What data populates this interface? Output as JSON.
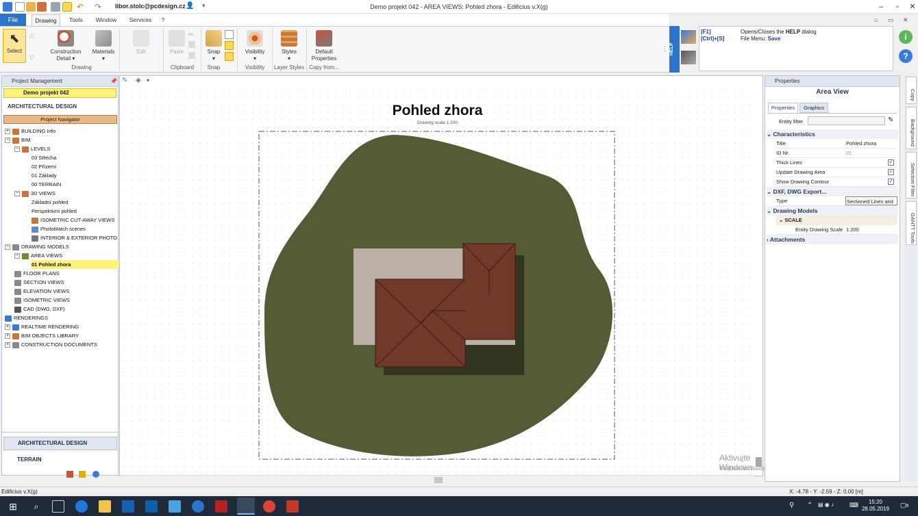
{
  "window": {
    "user": "libor.stolc@pcdesign.cz",
    "title": "Demo projekt 042  -  AREA VIEWS: Pohled zhora - Edificius v.X(g)"
  },
  "menu": {
    "file": "File",
    "tabs": [
      "Drawing",
      "Tools",
      "Window",
      "Services",
      "?"
    ]
  },
  "ribbon": {
    "select": "Select",
    "construction_detail": "Construction Detail",
    "materials": "Materials",
    "edit": "Edit",
    "paste": "Paste",
    "snap": "Snap",
    "visibility": "Visibility",
    "styles": "Styles",
    "default_properties": "Default Properties",
    "groups": [
      "Drawing",
      "Clipboard",
      "Snap",
      "Visibility",
      "Layer Styles",
      "Copy from..."
    ],
    "help_strip": "HELP"
  },
  "help": {
    "key1": "[F1]",
    "key2": "[Ctrl]+[S]",
    "desc1_pre": "Opens/Closes the ",
    "desc1_bold": "HELP",
    "desc1_post": " dialog",
    "desc2_pre": "File Menu: ",
    "desc2_bold": "Save"
  },
  "left_panel": {
    "header": "Project Management",
    "project": "Demo projekt 042",
    "section": "ARCHITECTURAL DESIGN",
    "navigator": "Project Navigator",
    "tree": [
      "BUILDING Info",
      "BIM",
      "LEVELS",
      "03 Střecha",
      "02 Přízemí",
      "01 Základy",
      "00 TERRAIN",
      "3D VIEWS",
      "Základní pohled",
      "Perspektivní pohled",
      "ISOMETRIC CUT-AWAY VIEWS",
      "PhotoMatch scenes",
      "INTERIOR & EXTERIOR PHOTO",
      "DRAWING MODELS",
      "AREA VIEWS",
      "01 Pohled zhora",
      "FLOOR PLANS",
      "SECTION VIEWS",
      "ELEVATION VIEWS",
      "ISOMETRIC VIEWS",
      "CAD (DWG, DXF)",
      "RENDERINGS",
      "REALTIME RENDERING",
      "BIM OBJECTS LIBRARY",
      "CONSTRUCTION DOCUMENTS"
    ],
    "bottom_arch": "ARCHITECTURAL DESIGN",
    "bottom_terrain": "TERRAIN"
  },
  "drawing": {
    "title": "Pohled zhora",
    "scale": "Drawing scale 1:200"
  },
  "properties": {
    "header": "Properties",
    "title": "Area View",
    "tab_properties": "Properties",
    "tab_graphics": "Graphics",
    "entity_filter": "Entity filter",
    "cat_characteristics": "Characteristics",
    "title_label": "Title",
    "title_value": "Pohled zhora",
    "id_label": "ID Nr.",
    "id_value": "01",
    "thick_lines": "Thick Lines",
    "update_area": "Update Drawing Area",
    "show_contour": "Show Drawing Contour",
    "cat_dxf": "DXF, DWG Export...",
    "type_label": "Type",
    "type_value": "Sectioned Lines and",
    "cat_models": "Drawing Models",
    "sub_scale": "SCALE",
    "entity_scale_label": "Entity Drawing Scale",
    "entity_scale_value": "1:200",
    "cat_attachments": "Attachments"
  },
  "side_tabs": [
    "Copy",
    "Background",
    "Selection Filter",
    "GANTT Tools"
  ],
  "watermark": {
    "line1": "Aktivujte Windows",
    "line2": "Prejdete do Nastavení a aktivujte systém Windows."
  },
  "status": {
    "app": "Edificius v.X(g)",
    "coords": "X: -4.78 - Y: -2.59 - Z: 0.00 [m]"
  },
  "taskbar": {
    "time": "15:20",
    "date": "28.05.2019",
    "notifications": "6"
  }
}
